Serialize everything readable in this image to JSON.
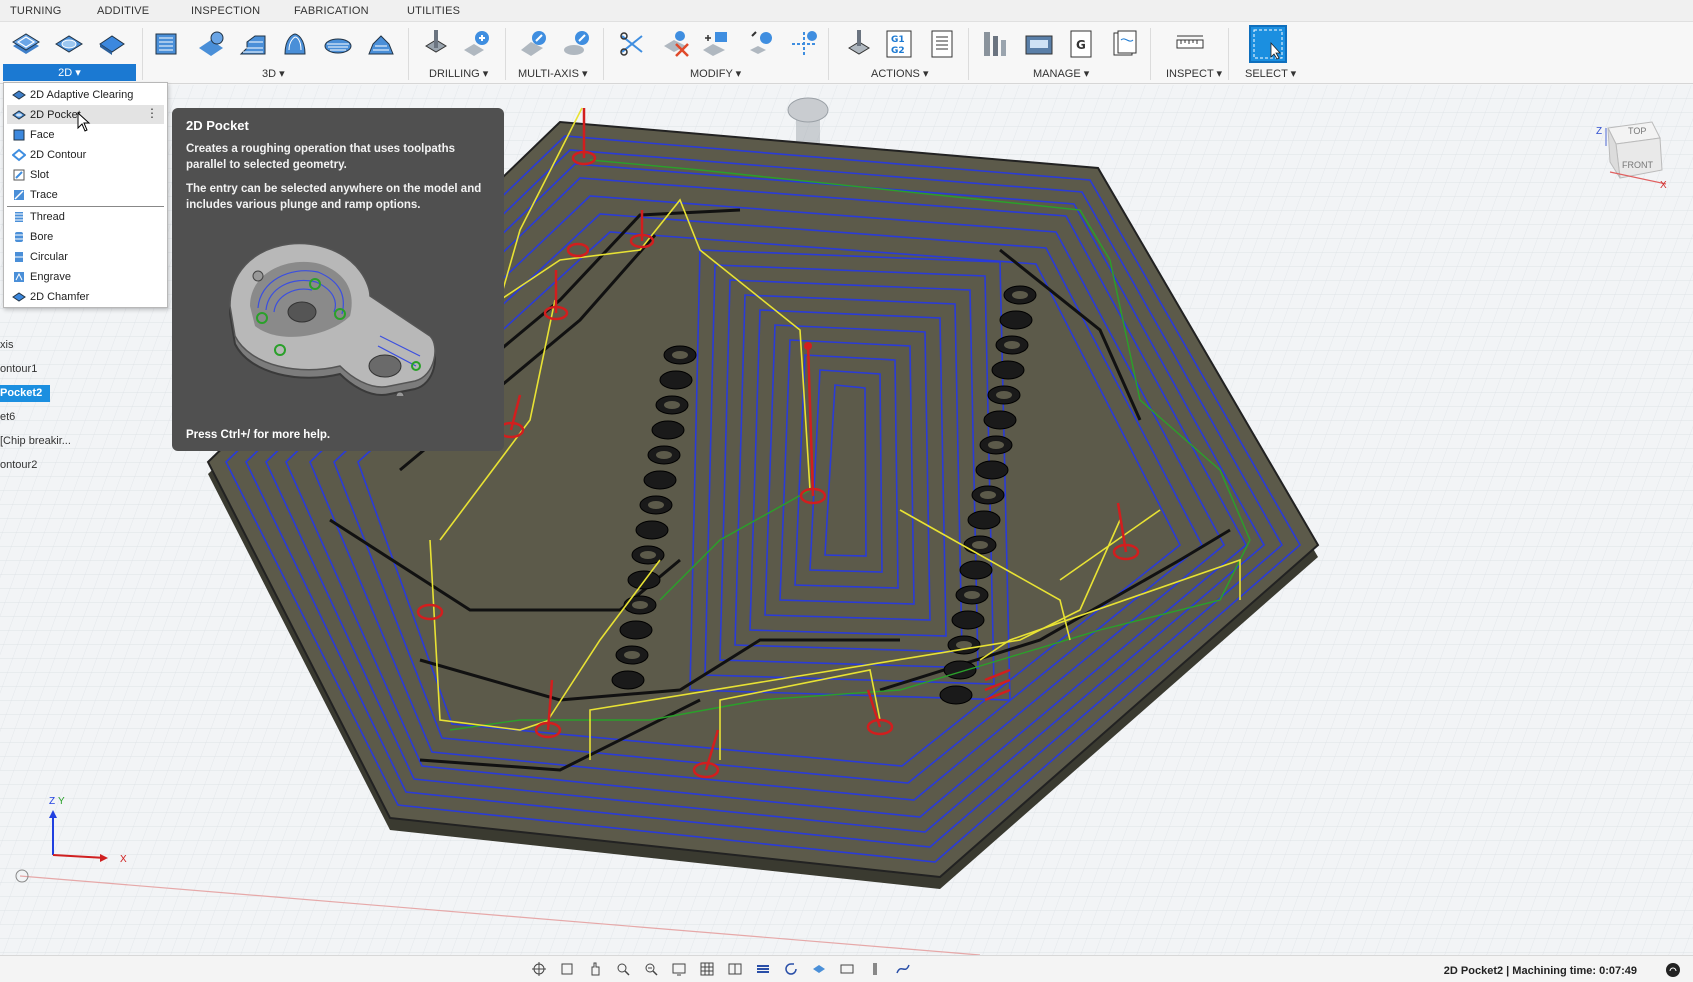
{
  "tabs": [
    "TURNING",
    "ADDITIVE",
    "INSPECTION",
    "FABRICATION",
    "UTILITIES"
  ],
  "toolbar": {
    "groups": {
      "g2d": "2D ▾",
      "g3d": "3D ▾",
      "drilling": "DRILLING ▾",
      "multiaxis": "MULTI-AXIS ▾",
      "modify": "MODIFY ▾",
      "actions": "ACTIONS ▾",
      "manage": "MANAGE ▾",
      "inspect": "INSPECT ▾",
      "select": "SELECT ▾"
    }
  },
  "dropdown": {
    "items": [
      {
        "label": "2D Adaptive Clearing",
        "icon": "adaptive-icon"
      },
      {
        "label": "2D Pocket",
        "icon": "pocket-icon"
      },
      {
        "label": "Face",
        "icon": "face-icon"
      },
      {
        "label": "2D Contour",
        "icon": "contour-icon"
      },
      {
        "label": "Slot",
        "icon": "slot-icon"
      },
      {
        "label": "Trace",
        "icon": "trace-icon"
      },
      {
        "label": "Thread",
        "icon": "thread-icon"
      },
      {
        "label": "Bore",
        "icon": "bore-icon"
      },
      {
        "label": "Circular",
        "icon": "circular-icon"
      },
      {
        "label": "Engrave",
        "icon": "engrave-icon"
      },
      {
        "label": "2D Chamfer",
        "icon": "chamfer-icon"
      }
    ],
    "more": "⋮"
  },
  "tooltip": {
    "title": "2D Pocket",
    "desc1": "Creates a roughing operation that uses toolpaths parallel to selected geometry.",
    "desc2": "The entry can be selected anywhere on the model and includes various plunge and ramp options.",
    "footer": "Press Ctrl+/ for more help."
  },
  "browser": {
    "items": [
      "xis",
      "ontour1",
      "Pocket2",
      "et6",
      "[Chip breakir...",
      "ontour2"
    ]
  },
  "viewcube": {
    "top": "TOP",
    "front": "FRONT",
    "x": "X",
    "z": "Z"
  },
  "triad": {
    "x": "X",
    "y": "Y",
    "z": "Z"
  },
  "status": {
    "text": "2D Pocket2 | Machining time: 0:07:49"
  },
  "colors": {
    "accent": "#1b8fe0",
    "toolpath": "#2a3bd8",
    "rapid": "#e8e234",
    "lead": "#2aa02a",
    "plunge": "#d21e1e",
    "stock": "#5c5a4a"
  }
}
